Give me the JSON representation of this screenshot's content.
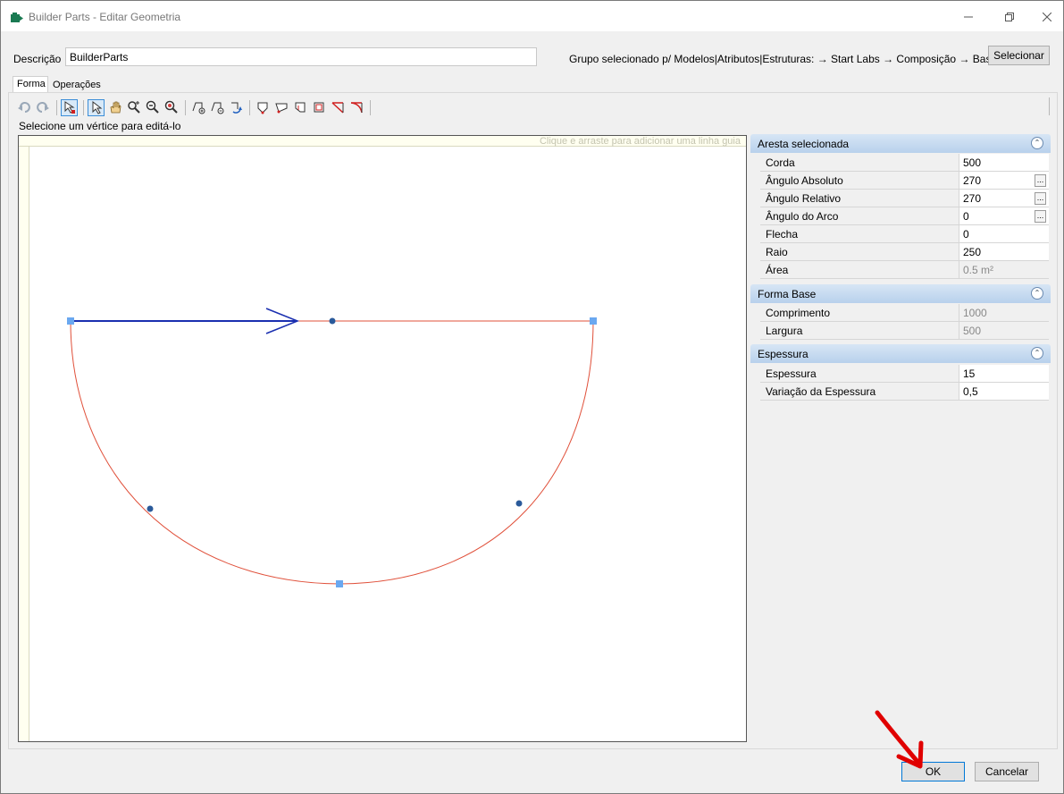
{
  "window": {
    "title": "Builder Parts - Editar Geometria"
  },
  "header": {
    "description_label": "Descrição",
    "description_value": "BuilderParts",
    "group_text": "Grupo selecionado p/ Modelos|Atributos|Estruturas:  → Start Labs → Composição → Bases",
    "select_button": "Selecionar"
  },
  "tabs": [
    {
      "label": "Forma",
      "active": true
    },
    {
      "label": "Operações",
      "active": false
    }
  ],
  "toolbar": {
    "icons": [
      "undo-icon",
      "redo-icon",
      "edit-vertex-icon",
      "select-icon",
      "pan-icon",
      "zoom-in-icon",
      "zoom-out-icon",
      "zoom-fit-icon",
      "add-node-icon",
      "remove-node-icon",
      "rotate-icon",
      "shape-1-icon",
      "shape-2-icon",
      "shape-3-icon",
      "shape-4-icon",
      "shape-5-icon",
      "shape-6-icon"
    ],
    "active_tool": "select-icon"
  },
  "canvas": {
    "hint": "Selecione um vértice para editá-lo",
    "guide_hint": "Clique e arraste para adicionar uma linha guia"
  },
  "properties": {
    "selected_edge": {
      "title": "Aresta selecionada",
      "rows": [
        {
          "name": "Corda",
          "value": "500"
        },
        {
          "name": "Ângulo Absoluto",
          "value": "270"
        },
        {
          "name": "Ângulo Relativo",
          "value": "270"
        },
        {
          "name": "Ângulo do Arco",
          "value": "0"
        },
        {
          "name": "Flecha",
          "value": "0"
        },
        {
          "name": "Raio",
          "value": "250"
        },
        {
          "name": "Área",
          "value": "0.5 m²"
        }
      ]
    },
    "base_shape": {
      "title": "Forma Base",
      "rows": [
        {
          "name": "Comprimento",
          "value": "1000"
        },
        {
          "name": "Largura",
          "value": "500"
        }
      ]
    },
    "thickness": {
      "title": "Espessura",
      "rows": [
        {
          "name": "Espessura",
          "value": "15"
        },
        {
          "name": "Variação da Espessura",
          "value": "0,5"
        }
      ]
    }
  },
  "footer": {
    "ok_label": "OK",
    "cancel_label": "Cancelar"
  },
  "colors": {
    "edge": "#e0503a",
    "selected_edge": "#1a2fb0",
    "vertex": "#6aa8f0",
    "midpoint": "#2a5a9a",
    "annotation_arrow": "#e00000"
  }
}
